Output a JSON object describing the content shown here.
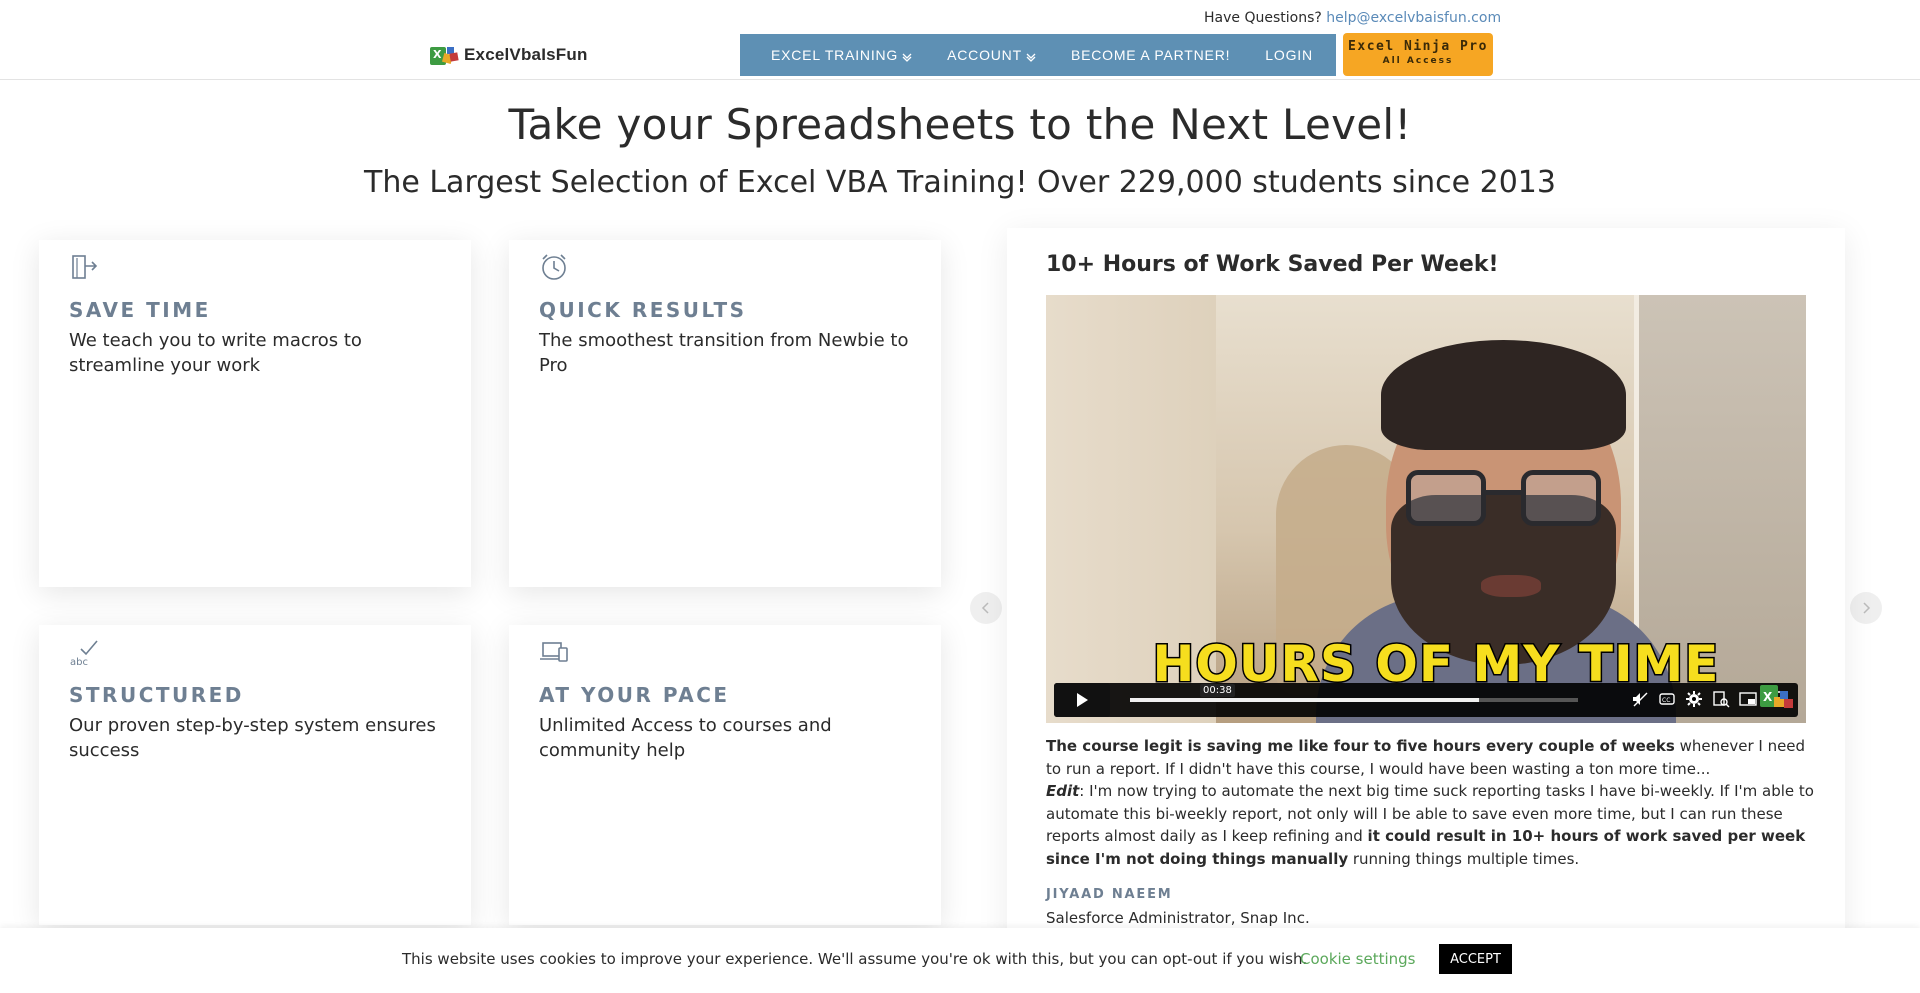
{
  "header": {
    "logo_text": "ExcelVbaIsFun",
    "questions_label": "Have Questions?",
    "email": "help@excelvbaisfun.com",
    "nav": [
      {
        "label": "EXCEL TRAINING",
        "dropdown": true
      },
      {
        "label": "ACCOUNT",
        "dropdown": true
      },
      {
        "label": "BECOME A PARTNER!",
        "dropdown": false
      },
      {
        "label": "LOGIN",
        "dropdown": false
      }
    ],
    "cta_line1": "Excel Ninja Pro",
    "cta_line2": "All Access",
    "colors": {
      "nav_bg": "#5e90b4",
      "cta_bg": "#f6a623"
    }
  },
  "hero": {
    "title": "Take your Spreadsheets to the Next Level!",
    "subtitle": "The Largest Selection of Excel VBA Training! Over 229,000 students since 2013"
  },
  "features": [
    {
      "icon": "exit-door-icon",
      "title": "SAVE TIME",
      "description": "We teach you to write macros to streamline your work"
    },
    {
      "icon": "alarm-clock-icon",
      "title": "QUICK RESULTS",
      "description": "The smoothest transition from Newbie to Pro"
    },
    {
      "icon": "spellcheck-icon",
      "title": "STRUCTURED",
      "description": "Our proven step-by-step system ensures success"
    },
    {
      "icon": "laptop-phone-icon",
      "title": "AT YOUR PACE",
      "description": "Unlimited Access to courses and community help"
    }
  ],
  "testimonial": {
    "heading": "10+ Hours of Work Saved Per Week!",
    "video": {
      "caption": "HOURS OF MY TIME",
      "time": "00:38",
      "progress": 0.78
    },
    "quote_bold_1": "The course legit is saving me like four to five hours every couple of weeks",
    "quote_text_1": " whenever I need to run a report. If I didn't have this course, I would have been wasting a ton more time...",
    "quote_edit_label": "Edit",
    "quote_text_2": ": I'm now trying to automate the next big time suck reporting tasks I have bi-weekly. If I'm able to automate this bi-weekly report, not only will I be able to save even more time, but I can run these reports almost daily as I keep refining and ",
    "quote_bold_2": "it could result in 10+ hours of work saved per week since I'm not doing things manually",
    "quote_text_3": " running things multiple times.",
    "author": "JIYAAD NAEEM",
    "role": "Salesforce Administrator, Snap Inc."
  },
  "cookie": {
    "text": "This website uses cookies to improve your experience. We'll assume you're ok with this, but you can opt-out if you wish.",
    "settings_label": "Cookie settings",
    "accept_label": "ACCEPT",
    "settings_color": "#5ba85b"
  }
}
